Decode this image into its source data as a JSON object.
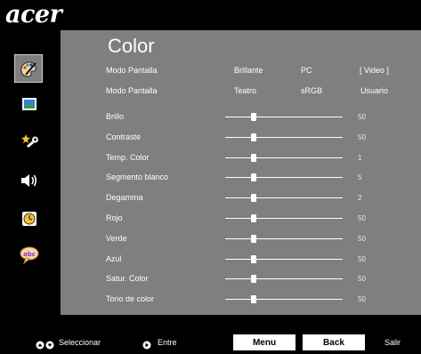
{
  "brand": {
    "logo": "acer"
  },
  "menu": {
    "title": "Color",
    "icons": [
      {
        "name": "color-icon",
        "selected": true
      },
      {
        "name": "image-icon",
        "selected": false
      },
      {
        "name": "management-icon",
        "selected": false
      },
      {
        "name": "audio-icon",
        "selected": false
      },
      {
        "name": "timer-icon",
        "selected": false
      },
      {
        "name": "language-icon",
        "selected": false
      }
    ]
  },
  "display_mode": {
    "row1": {
      "label": "Modo Pantalla",
      "options": [
        "Brillante",
        "PC",
        "[ Video ]"
      ]
    },
    "row2": {
      "label": "Modo Pantalla",
      "options": [
        "Teatro",
        "sRGB",
        "Usuario"
      ]
    },
    "selected": "Video"
  },
  "sliders": [
    {
      "label": "Brillo",
      "value": "50",
      "level": 0.22
    },
    {
      "label": "Contraste",
      "value": "50",
      "level": 0.22
    },
    {
      "label": "Temp. Color",
      "value": "1",
      "level": 0.22
    },
    {
      "label": "Segmento blanco",
      "value": "5",
      "level": 0.22
    },
    {
      "label": "Degamma",
      "value": "2",
      "level": 0.22
    },
    {
      "label": "Rojo",
      "value": "50",
      "level": 0.22
    },
    {
      "label": "Verde",
      "value": "50",
      "level": 0.22
    },
    {
      "label": "Azul",
      "value": "50",
      "level": 0.22
    },
    {
      "label": "Satur. Color",
      "value": "50",
      "level": 0.22
    },
    {
      "label": "Tono de color",
      "value": "50",
      "level": 0.22
    }
  ],
  "footer": {
    "select_label": "Seleccionar",
    "enter_label": "Entre",
    "menu_button": "Menu",
    "back_button": "Back",
    "exit_label": "Salir"
  }
}
